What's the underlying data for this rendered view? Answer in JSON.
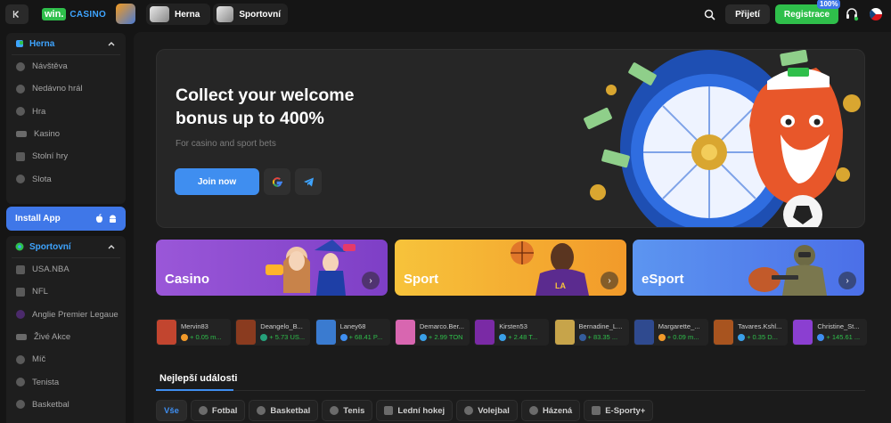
{
  "topbar": {
    "logo_win": "win.",
    "logo_casino": "CASINO",
    "nav": [
      {
        "label": "Herna"
      },
      {
        "label": "Sportovní"
      }
    ],
    "login_label": "Přijetí",
    "register_label": "Registrace",
    "register_badge": "100%"
  },
  "sidebar": {
    "casino_section": {
      "title": "Herna",
      "items": [
        {
          "label": "Návštěva"
        },
        {
          "label": "Nedávno hrál"
        },
        {
          "label": "Hra"
        },
        {
          "label": "Kasino"
        },
        {
          "label": "Stolní hry"
        },
        {
          "label": "Slota"
        }
      ]
    },
    "install_label": "Install App",
    "sport_section": {
      "title": "Sportovní",
      "items": [
        {
          "label": "USA.NBA"
        },
        {
          "label": "NFL"
        },
        {
          "label": "Anglie Premier Legaue"
        },
        {
          "label": "Živé Akce"
        },
        {
          "label": "Míč"
        },
        {
          "label": "Tenista"
        },
        {
          "label": "Basketbal"
        }
      ]
    }
  },
  "hero": {
    "title": "Collect your welcome bonus up to 400%",
    "subtitle": "For casino and sport bets",
    "join_label": "Join now"
  },
  "tiles": [
    {
      "label": "Casino"
    },
    {
      "label": "Sport"
    },
    {
      "label": "eSport"
    }
  ],
  "winners": [
    {
      "name": "Mervin83",
      "amount": "+ 0.05 m...",
      "coin": "#f29a2a"
    },
    {
      "name": "Deangelo_B...",
      "amount": "+ 5.73 US...",
      "coin": "#26a17b"
    },
    {
      "name": "Laney68",
      "amount": "+ 68.41 P...",
      "coin": "#3f8ef0"
    },
    {
      "name": "Demarco.Ber...",
      "amount": "+ 2.99 TON",
      "coin": "#3aa0e8"
    },
    {
      "name": "Kirsten53",
      "amount": "+ 2.48 T...",
      "coin": "#3aa0e8"
    },
    {
      "name": "Bernadine_L...",
      "amount": "+ 83.35 ...",
      "coin": "#345d9d"
    },
    {
      "name": "Margarette_...",
      "amount": "+ 0.09 m...",
      "coin": "#f29a2a"
    },
    {
      "name": "Tavares.Kshl...",
      "amount": "+ 0.35 D...",
      "coin": "#3aa0e8"
    },
    {
      "name": "Christine_St...",
      "amount": "+ 145.61 ...",
      "coin": "#3f8ef0"
    }
  ],
  "events": {
    "title": "Nejlepší události",
    "filters": [
      {
        "label": "Vše"
      },
      {
        "label": "Fotbal"
      },
      {
        "label": "Basketbal"
      },
      {
        "label": "Tenis"
      },
      {
        "label": "Lední hokej"
      },
      {
        "label": "Volejbal"
      },
      {
        "label": "Házená"
      },
      {
        "label": "E-Sporty+"
      }
    ]
  },
  "colors": {
    "accent_green": "#2fbf4b",
    "accent_blue": "#3f8ef0",
    "background": "#151515"
  }
}
